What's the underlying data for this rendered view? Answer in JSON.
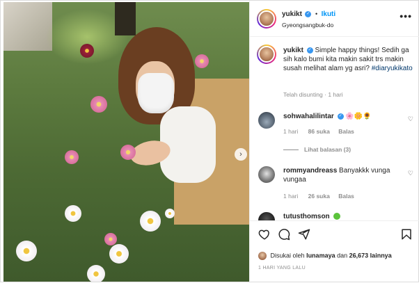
{
  "post": {
    "author": "yukikt",
    "separator": "•",
    "follow_label": "Ikuti",
    "location": "Gyeongsangbuk-do",
    "more_label": "•••"
  },
  "caption": {
    "author": "yukikt",
    "text": "Simple happy things! Sedih ga sih kalo bumi kita makin sakit trs makin susah melihat alam yg asri?",
    "hashtag": "#diaryukikato",
    "edited_label": "Telah disunting",
    "separator": "·",
    "time": "1 hari"
  },
  "comments": [
    {
      "user": "sohwahalilintar",
      "text": "🌸🌼🌻",
      "time": "1 hari",
      "likes": "86 suka",
      "reply_label": "Balas",
      "view_replies": "Lihat balasan (3)"
    },
    {
      "user": "rommyandreass",
      "text": "Banyakkk vunga vungaa",
      "time": "1 hari",
      "likes": "26 suka",
      "reply_label": "Balas"
    },
    {
      "user": "tutusthomson",
      "text": ""
    }
  ],
  "footer": {
    "liked_by_prefix": "Disukai oleh",
    "liked_by_user": "lunamaya",
    "liked_by_conj": "dan",
    "liked_by_count": "26,673 lainnya",
    "time_ago": "1 HARI YANG LALU"
  },
  "icons": {
    "like": "heart-icon",
    "comment": "comment-icon",
    "share": "send-icon",
    "save": "bookmark-icon",
    "next": "chevron-right-icon"
  },
  "colors": {
    "link_blue": "#0095f6",
    "verified_blue": "#3897f0",
    "hashtag": "#00376b",
    "muted": "#8e8e8e"
  }
}
